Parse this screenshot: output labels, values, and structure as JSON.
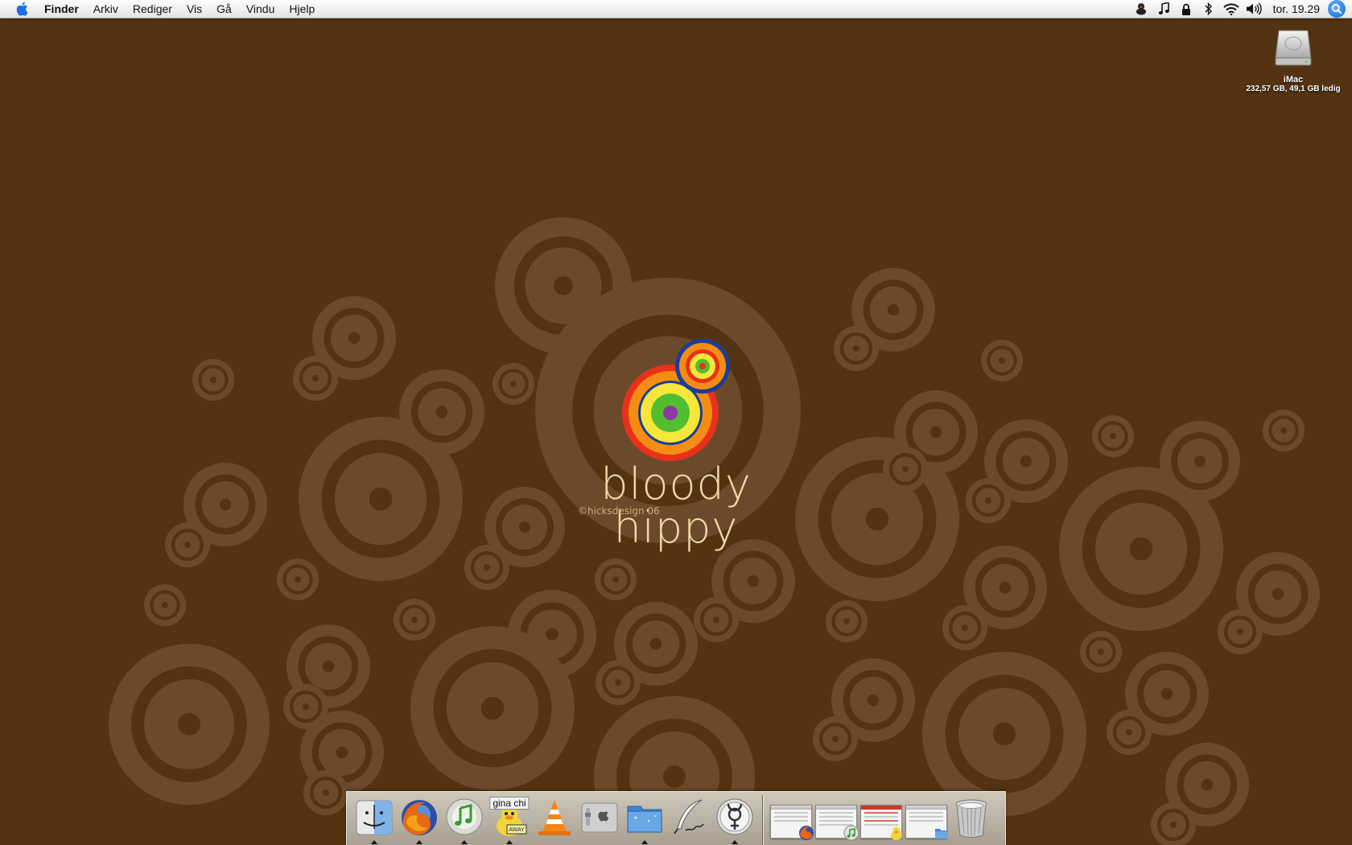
{
  "menubar": {
    "apple_icon": "apple-logo-icon",
    "app_name": "Finder",
    "menus": [
      "Arkiv",
      "Rediger",
      "Vis",
      "Gå",
      "Vindu",
      "Hjelp"
    ],
    "status_icons": [
      "adium-duck-icon",
      "music-note-icon",
      "lock-icon",
      "bluetooth-icon",
      "wifi-icon",
      "volume-icon"
    ],
    "clock": "tor. 19.29",
    "spotlight_icon": "spotlight-icon"
  },
  "desktop": {
    "drive_name": "iMac",
    "drive_info": "232,57 GB, 49,1 GB ledig"
  },
  "wallpaper": {
    "title": "bloody hippy",
    "credit": "©hicksdesign 06",
    "background": "#533312",
    "ring_color": "#6b4a2b"
  },
  "dock": {
    "apps": [
      {
        "name": "Finder",
        "icon": "finder-icon",
        "running": true
      },
      {
        "name": "Firefox",
        "icon": "firefox-icon",
        "running": true
      },
      {
        "name": "iTunes",
        "icon": "itunes-icon",
        "running": true
      },
      {
        "name": "Adium",
        "icon": "adium-icon",
        "running": true,
        "badge": "gina chi"
      },
      {
        "name": "VLC",
        "icon": "vlc-icon",
        "running": false
      },
      {
        "name": "System Preferences",
        "icon": "system-preferences-icon",
        "running": false
      },
      {
        "name": "Desktop Folder",
        "icon": "folder-icon",
        "running": true
      },
      {
        "name": "Script Editor",
        "icon": "quill-icon",
        "running": false
      },
      {
        "name": "Transmission",
        "icon": "mercury-symbol-icon",
        "running": true
      }
    ],
    "minimized_windows": [
      {
        "name": "Firefox window",
        "icon": "window-thumbnail-firefox-icon"
      },
      {
        "name": "iTunes window",
        "icon": "window-thumbnail-itunes-icon"
      },
      {
        "name": "Adium window",
        "icon": "window-thumbnail-adium-icon"
      },
      {
        "name": "Finder window",
        "icon": "window-thumbnail-finder-icon"
      }
    ],
    "trash": {
      "name": "Trash",
      "icon": "trash-icon"
    }
  }
}
